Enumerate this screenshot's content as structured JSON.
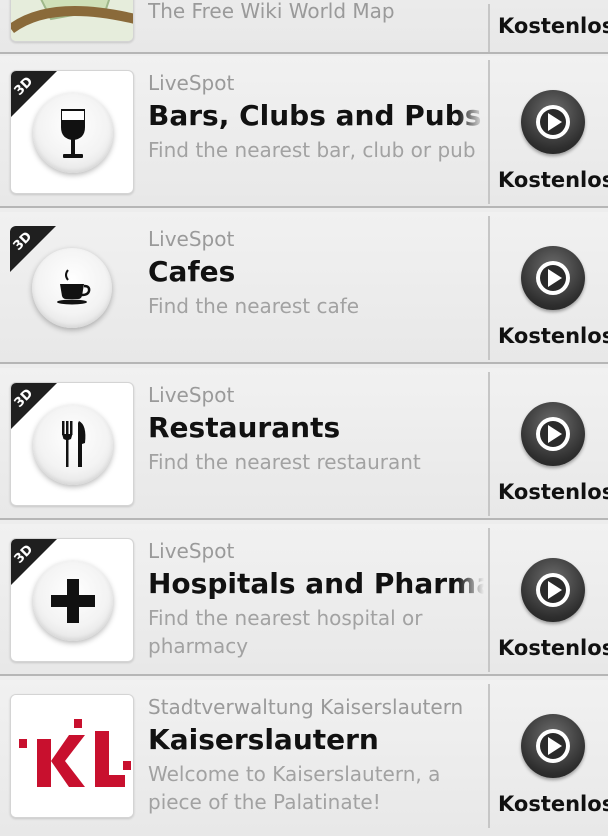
{
  "apps": [
    {
      "developer": "The Free Wiki World Map",
      "title": "",
      "description": "",
      "price": "Kostenlos",
      "icon": "map-icon",
      "badge": ""
    },
    {
      "developer": "LiveSpot",
      "title": "Bars, Clubs and Pubs",
      "description": "Find the nearest bar, club or pub",
      "price": "Kostenlos",
      "icon": "wine-glass-icon",
      "badge": "3D"
    },
    {
      "developer": "LiveSpot",
      "title": "Cafes",
      "description": "Find the nearest cafe",
      "price": "Kostenlos",
      "icon": "coffee-cup-icon",
      "badge": "3D"
    },
    {
      "developer": "LiveSpot",
      "title": "Restaurants",
      "description": "Find the nearest restaurant",
      "price": "Kostenlos",
      "icon": "fork-knife-icon",
      "badge": "3D"
    },
    {
      "developer": "LiveSpot",
      "title": "Hospitals and Pharmacies",
      "description": "Find the nearest hospital or pharmacy",
      "price": "Kostenlos",
      "icon": "medical-cross-icon",
      "badge": "3D"
    },
    {
      "developer": "Stadtverwaltung Kaiserslautern",
      "title": "Kaiserslautern",
      "description": "Welcome to Kaiserslautern, a piece of the Palatinate!",
      "price": "Kostenlos",
      "icon": "kl-logo-icon",
      "badge": "",
      "logo_text": "KL"
    }
  ],
  "colors": {
    "header_accent": "#2b5f95",
    "logo_red": "#c8102e"
  }
}
